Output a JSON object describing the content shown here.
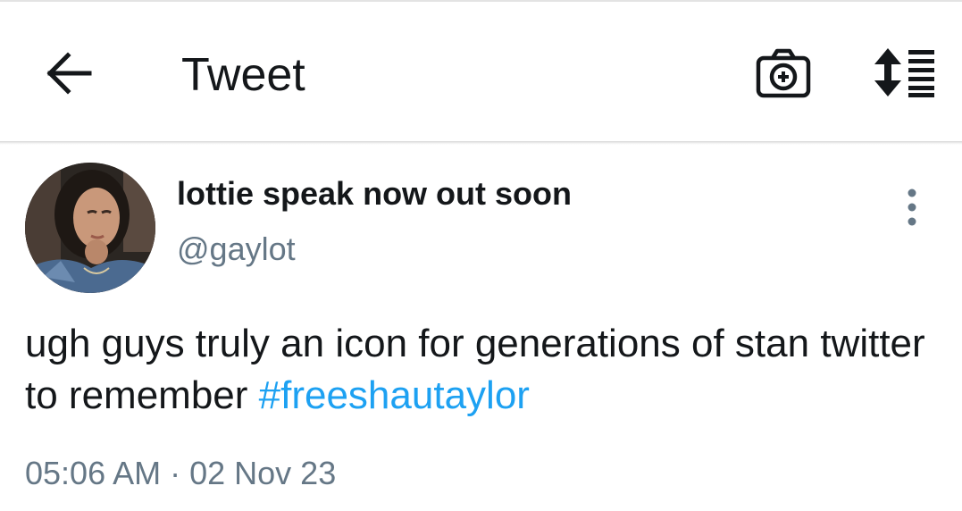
{
  "header": {
    "title": "Tweet",
    "icons": {
      "back": "arrow-left-icon",
      "camera": "camera-plus-icon",
      "sort": "sort-lines-icon"
    }
  },
  "tweet": {
    "author": {
      "display_name": "lottie speak now out soon",
      "handle": "@gaylot"
    },
    "text_parts": [
      "ugh guys truly an icon for generations of stan twitter to remember "
    ],
    "hashtag": "#freeshautaylor",
    "time": "05:06 AM",
    "separator": " · ",
    "date": "02 Nov 23"
  },
  "colors": {
    "link": "#1da1f2",
    "secondary": "#657786",
    "text": "#14171a"
  }
}
